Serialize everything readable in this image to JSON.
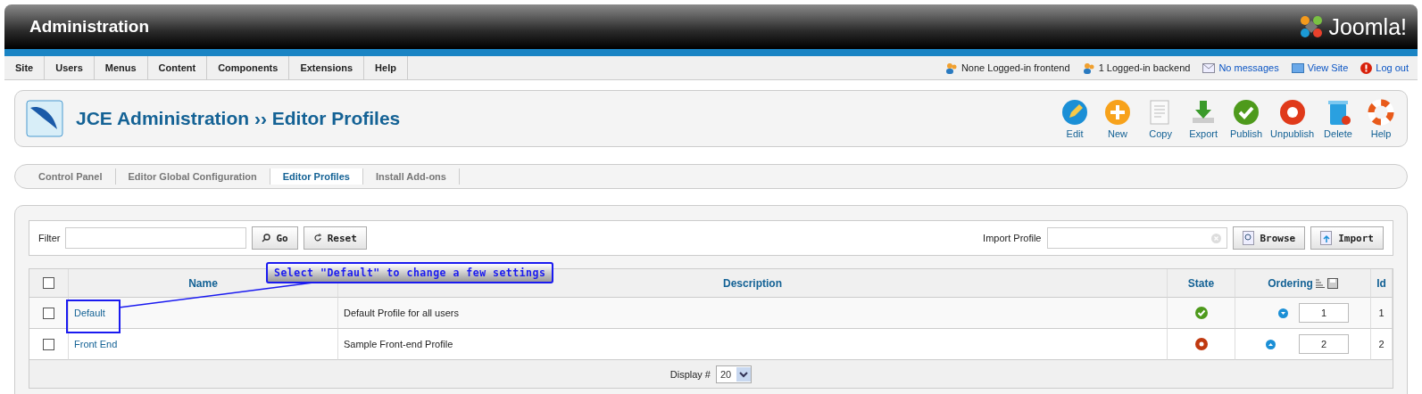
{
  "header": {
    "title": "Administration",
    "logo_text": "Joomla!"
  },
  "menu": [
    {
      "label": "Site"
    },
    {
      "label": "Users"
    },
    {
      "label": "Menus"
    },
    {
      "label": "Content"
    },
    {
      "label": "Components"
    },
    {
      "label": "Extensions"
    },
    {
      "label": "Help"
    }
  ],
  "status": [
    {
      "kind": "users",
      "label": "None Logged-in frontend",
      "link": false
    },
    {
      "kind": "users",
      "label": "1 Logged-in backend",
      "link": false
    },
    {
      "kind": "messages",
      "label": "No messages",
      "link": true
    },
    {
      "kind": "site",
      "label": "View Site",
      "link": true
    },
    {
      "kind": "logout",
      "label": "Log out",
      "link": true
    }
  ],
  "page_title": "JCE Administration ›› Editor Profiles",
  "toolbar": [
    {
      "kind": "edit",
      "label": "Edit"
    },
    {
      "kind": "new",
      "label": "New"
    },
    {
      "kind": "copy",
      "label": "Copy"
    },
    {
      "kind": "export",
      "label": "Export"
    },
    {
      "kind": "publish",
      "label": "Publish"
    },
    {
      "kind": "unpublish",
      "label": "Unpublish"
    },
    {
      "kind": "delete",
      "label": "Delete"
    },
    {
      "kind": "help",
      "label": "Help"
    }
  ],
  "submenu": [
    {
      "label": "Control Panel",
      "selected": false
    },
    {
      "label": "Editor Global Configuration",
      "selected": false
    },
    {
      "label": "Editor Profiles",
      "selected": true
    },
    {
      "label": "Install Add-ons",
      "selected": false
    }
  ],
  "filter": {
    "label": "Filter",
    "go": "Go",
    "reset": "Reset",
    "import_label": "Import Profile",
    "browse": "Browse",
    "import": "Import"
  },
  "table": {
    "select_all_checked": false,
    "columns": [
      "Name",
      "Description",
      "State",
      "Ordering",
      "Id"
    ],
    "rows": [
      {
        "checked": false,
        "name": "Default",
        "description": "Default Profile for all users",
        "published": true,
        "kind": "move_down",
        "order": "1",
        "id": "1"
      },
      {
        "checked": false,
        "name": "Front End",
        "description": "Sample Front-end Profile",
        "published": false,
        "kind": "move_up",
        "order": "2",
        "id": "2"
      }
    ],
    "display_label": "Display #",
    "display_value": "20"
  },
  "callout": {
    "text": "Select \"Default\" to change a few settings"
  }
}
